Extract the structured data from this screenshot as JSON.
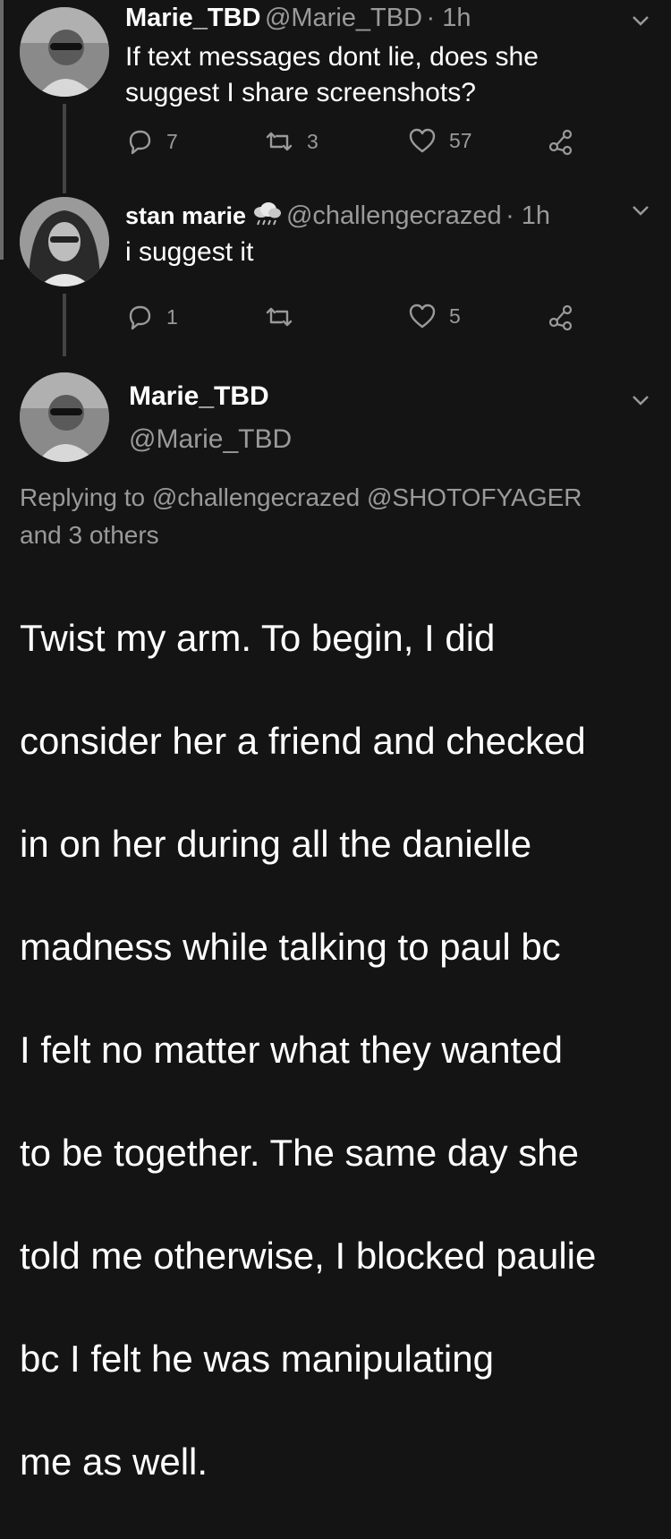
{
  "colors": {
    "background": "#141414",
    "secondary_text": "#9a9a9a",
    "thread_line": "#444444"
  },
  "tweets": [
    {
      "name": "Marie_TBD",
      "handle": "@Marie_TBD",
      "time": "· 1h",
      "text_lines": [
        "If text messages dont lie, does she",
        "suggest I share screenshots?"
      ],
      "replies": "7",
      "retweets": "3",
      "likes": "57",
      "icons": [
        "reply-icon",
        "retweet-icon",
        "like-icon",
        "share-icon",
        "chevron-down-icon"
      ]
    },
    {
      "name": "stan marie",
      "name_emoji": "cloud-with-rain-icon",
      "handle": "@challengecrazed",
      "time": "· 1h",
      "text": "i suggest it",
      "replies": "1",
      "retweets": "",
      "likes": "5"
    }
  ],
  "main_tweet": {
    "name": "Marie_TBD",
    "handle": "@Marie_TBD",
    "replying_to_line1": "Replying to @challengecrazed @SHOTOFYAGER",
    "replying_to_line2": "and 3 others",
    "body_lines": [
      "Twist my arm. To begin, I did",
      "consider her a friend and checked",
      "in on her during all the danielle",
      "madness while talking to paul bc",
      "I felt no matter what they wanted",
      "to be together. The same day she",
      "told me otherwise, I blocked paulie",
      "bc I felt he was manipulating",
      "me as well."
    ]
  }
}
